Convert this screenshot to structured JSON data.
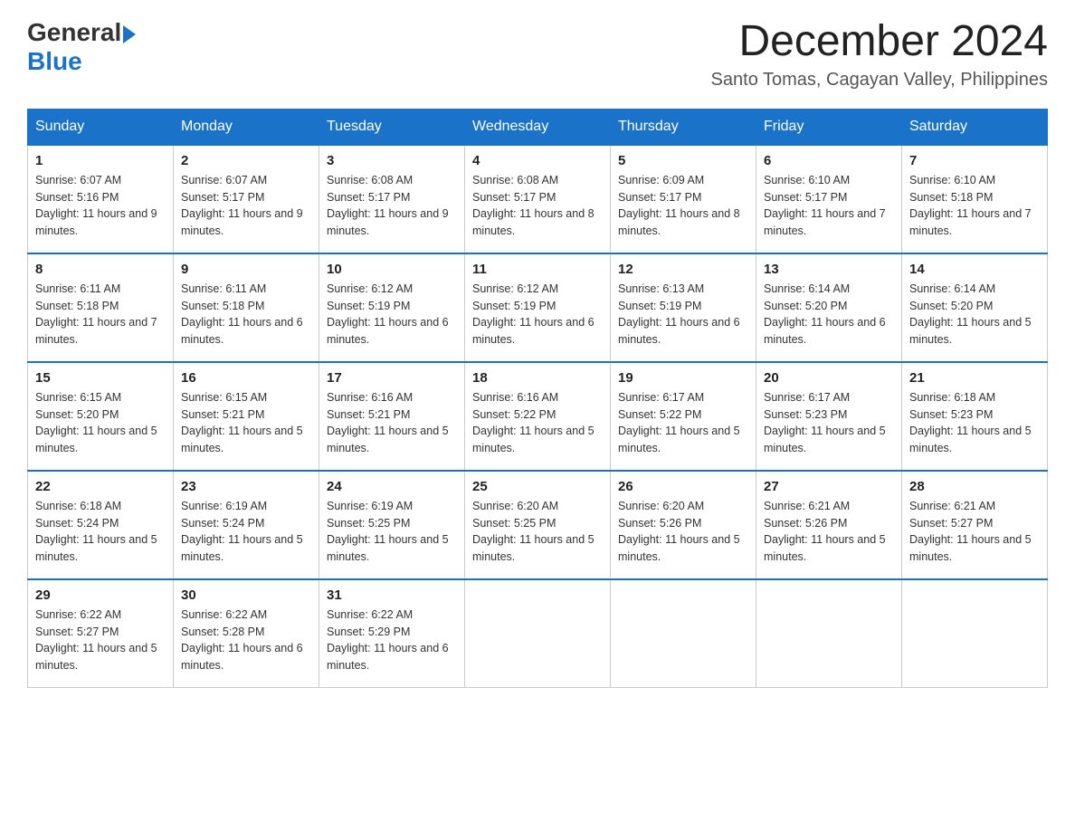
{
  "header": {
    "logo_general": "General",
    "logo_blue": "Blue",
    "month_year": "December 2024",
    "location": "Santo Tomas, Cagayan Valley, Philippines"
  },
  "weekdays": [
    "Sunday",
    "Monday",
    "Tuesday",
    "Wednesday",
    "Thursday",
    "Friday",
    "Saturday"
  ],
  "weeks": [
    [
      {
        "day": "1",
        "sunrise": "6:07 AM",
        "sunset": "5:16 PM",
        "daylight": "11 hours and 9 minutes."
      },
      {
        "day": "2",
        "sunrise": "6:07 AM",
        "sunset": "5:17 PM",
        "daylight": "11 hours and 9 minutes."
      },
      {
        "day": "3",
        "sunrise": "6:08 AM",
        "sunset": "5:17 PM",
        "daylight": "11 hours and 9 minutes."
      },
      {
        "day": "4",
        "sunrise": "6:08 AM",
        "sunset": "5:17 PM",
        "daylight": "11 hours and 8 minutes."
      },
      {
        "day": "5",
        "sunrise": "6:09 AM",
        "sunset": "5:17 PM",
        "daylight": "11 hours and 8 minutes."
      },
      {
        "day": "6",
        "sunrise": "6:10 AM",
        "sunset": "5:17 PM",
        "daylight": "11 hours and 7 minutes."
      },
      {
        "day": "7",
        "sunrise": "6:10 AM",
        "sunset": "5:18 PM",
        "daylight": "11 hours and 7 minutes."
      }
    ],
    [
      {
        "day": "8",
        "sunrise": "6:11 AM",
        "sunset": "5:18 PM",
        "daylight": "11 hours and 7 minutes."
      },
      {
        "day": "9",
        "sunrise": "6:11 AM",
        "sunset": "5:18 PM",
        "daylight": "11 hours and 6 minutes."
      },
      {
        "day": "10",
        "sunrise": "6:12 AM",
        "sunset": "5:19 PM",
        "daylight": "11 hours and 6 minutes."
      },
      {
        "day": "11",
        "sunrise": "6:12 AM",
        "sunset": "5:19 PM",
        "daylight": "11 hours and 6 minutes."
      },
      {
        "day": "12",
        "sunrise": "6:13 AM",
        "sunset": "5:19 PM",
        "daylight": "11 hours and 6 minutes."
      },
      {
        "day": "13",
        "sunrise": "6:14 AM",
        "sunset": "5:20 PM",
        "daylight": "11 hours and 6 minutes."
      },
      {
        "day": "14",
        "sunrise": "6:14 AM",
        "sunset": "5:20 PM",
        "daylight": "11 hours and 5 minutes."
      }
    ],
    [
      {
        "day": "15",
        "sunrise": "6:15 AM",
        "sunset": "5:20 PM",
        "daylight": "11 hours and 5 minutes."
      },
      {
        "day": "16",
        "sunrise": "6:15 AM",
        "sunset": "5:21 PM",
        "daylight": "11 hours and 5 minutes."
      },
      {
        "day": "17",
        "sunrise": "6:16 AM",
        "sunset": "5:21 PM",
        "daylight": "11 hours and 5 minutes."
      },
      {
        "day": "18",
        "sunrise": "6:16 AM",
        "sunset": "5:22 PM",
        "daylight": "11 hours and 5 minutes."
      },
      {
        "day": "19",
        "sunrise": "6:17 AM",
        "sunset": "5:22 PM",
        "daylight": "11 hours and 5 minutes."
      },
      {
        "day": "20",
        "sunrise": "6:17 AM",
        "sunset": "5:23 PM",
        "daylight": "11 hours and 5 minutes."
      },
      {
        "day": "21",
        "sunrise": "6:18 AM",
        "sunset": "5:23 PM",
        "daylight": "11 hours and 5 minutes."
      }
    ],
    [
      {
        "day": "22",
        "sunrise": "6:18 AM",
        "sunset": "5:24 PM",
        "daylight": "11 hours and 5 minutes."
      },
      {
        "day": "23",
        "sunrise": "6:19 AM",
        "sunset": "5:24 PM",
        "daylight": "11 hours and 5 minutes."
      },
      {
        "day": "24",
        "sunrise": "6:19 AM",
        "sunset": "5:25 PM",
        "daylight": "11 hours and 5 minutes."
      },
      {
        "day": "25",
        "sunrise": "6:20 AM",
        "sunset": "5:25 PM",
        "daylight": "11 hours and 5 minutes."
      },
      {
        "day": "26",
        "sunrise": "6:20 AM",
        "sunset": "5:26 PM",
        "daylight": "11 hours and 5 minutes."
      },
      {
        "day": "27",
        "sunrise": "6:21 AM",
        "sunset": "5:26 PM",
        "daylight": "11 hours and 5 minutes."
      },
      {
        "day": "28",
        "sunrise": "6:21 AM",
        "sunset": "5:27 PM",
        "daylight": "11 hours and 5 minutes."
      }
    ],
    [
      {
        "day": "29",
        "sunrise": "6:22 AM",
        "sunset": "5:27 PM",
        "daylight": "11 hours and 5 minutes."
      },
      {
        "day": "30",
        "sunrise": "6:22 AM",
        "sunset": "5:28 PM",
        "daylight": "11 hours and 6 minutes."
      },
      {
        "day": "31",
        "sunrise": "6:22 AM",
        "sunset": "5:29 PM",
        "daylight": "11 hours and 6 minutes."
      },
      null,
      null,
      null,
      null
    ]
  ]
}
